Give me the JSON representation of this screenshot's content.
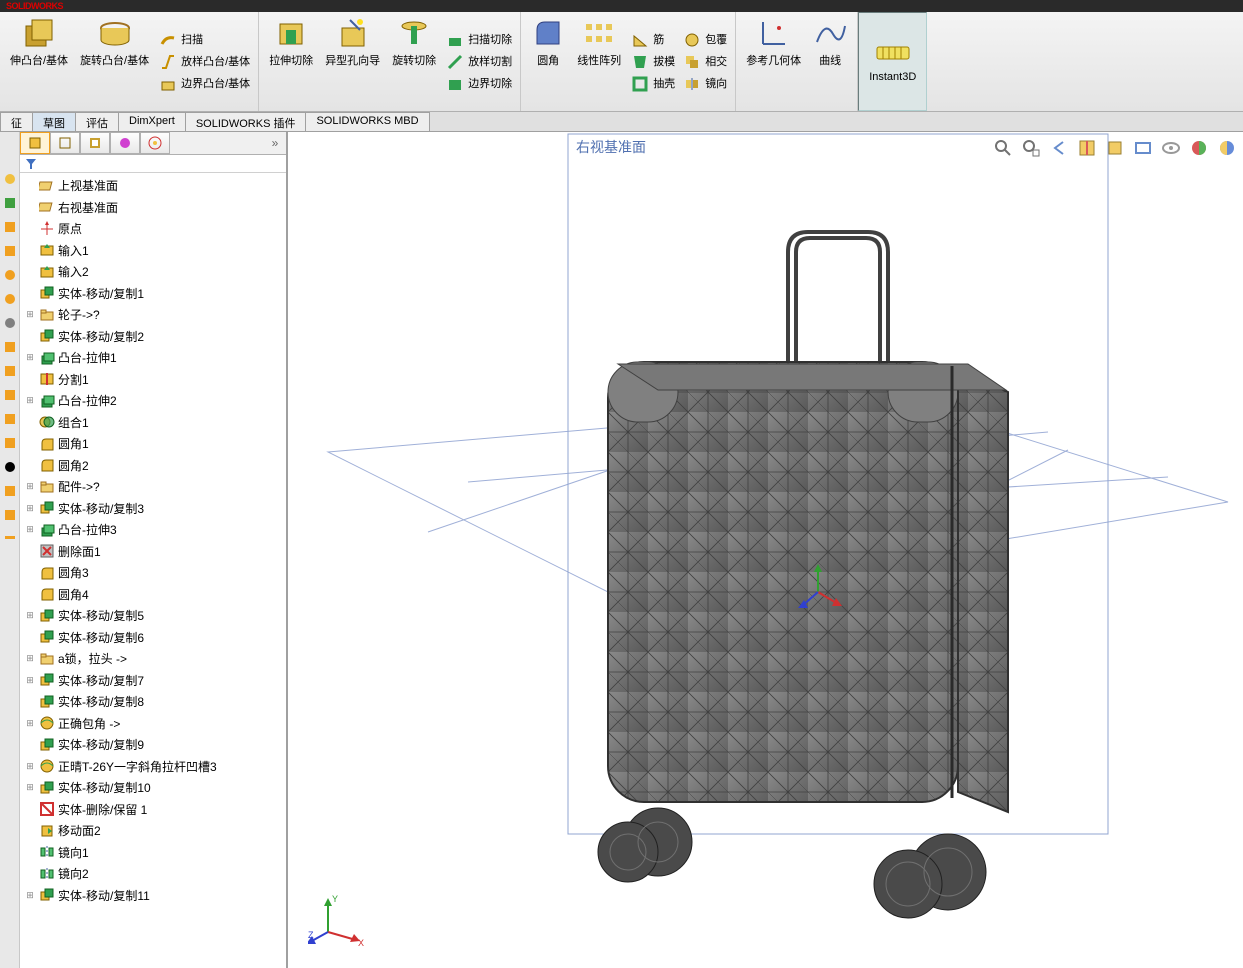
{
  "app": {
    "title": "SOLIDWORKS"
  },
  "ribbon": {
    "group1": {
      "big1": "伸凸台/基体",
      "big2": "旋转凸台/基体",
      "row1": "扫描",
      "row2": "放样凸台/基体",
      "row3": "边界凸台/基体"
    },
    "group2": {
      "big1": "拉伸切除",
      "big2": "异型孔向导",
      "big3": "旋转切除",
      "row1": "扫描切除",
      "row2": "放样切割",
      "row3": "边界切除"
    },
    "group3": {
      "big1": "圆角",
      "big2": "线性阵列",
      "row1": "筋",
      "row2": "拔模",
      "row3": "抽壳",
      "row4": "包覆",
      "row5": "相交",
      "row6": "镜向"
    },
    "group4": {
      "big1": "参考几何体",
      "big2": "曲线"
    },
    "instant3d": "Instant3D"
  },
  "tabs": [
    "征",
    "草图",
    "评估",
    "DimXpert",
    "SOLIDWORKS 插件",
    "SOLIDWORKS MBD"
  ],
  "viewport": {
    "plane_label": "右视基准面"
  },
  "tree": [
    {
      "icon": "plane",
      "label": "上视基准面",
      "exp": ""
    },
    {
      "icon": "plane",
      "label": "右视基准面",
      "exp": ""
    },
    {
      "icon": "origin",
      "label": "原点",
      "exp": ""
    },
    {
      "icon": "import",
      "label": "输入1",
      "exp": ""
    },
    {
      "icon": "import",
      "label": "输入2",
      "exp": ""
    },
    {
      "icon": "movecopy",
      "label": "实体-移动/复制1",
      "exp": ""
    },
    {
      "icon": "folder",
      "label": "轮子->?",
      "exp": "+"
    },
    {
      "icon": "movecopy",
      "label": "实体-移动/复制2",
      "exp": ""
    },
    {
      "icon": "extrude",
      "label": "凸台-拉伸1",
      "exp": "+"
    },
    {
      "icon": "split",
      "label": "分割1",
      "exp": ""
    },
    {
      "icon": "extrude",
      "label": "凸台-拉伸2",
      "exp": "+"
    },
    {
      "icon": "combine",
      "label": "组合1",
      "exp": ""
    },
    {
      "icon": "fillet",
      "label": "圆角1",
      "exp": ""
    },
    {
      "icon": "fillet",
      "label": "圆角2",
      "exp": ""
    },
    {
      "icon": "folder",
      "label": "配件->?",
      "exp": "+"
    },
    {
      "icon": "movecopy",
      "label": "实体-移动/复制3",
      "exp": "+"
    },
    {
      "icon": "extrude",
      "label": "凸台-拉伸3",
      "exp": "+"
    },
    {
      "icon": "deleteface",
      "label": "删除面1",
      "exp": ""
    },
    {
      "icon": "fillet",
      "label": "圆角3",
      "exp": ""
    },
    {
      "icon": "fillet",
      "label": "圆角4",
      "exp": ""
    },
    {
      "icon": "movecopy",
      "label": "实体-移动/复制5",
      "exp": "+"
    },
    {
      "icon": "movecopy",
      "label": "实体-移动/复制6",
      "exp": ""
    },
    {
      "icon": "folder",
      "label": "a锁，拉头 ->",
      "exp": "+"
    },
    {
      "icon": "movecopy",
      "label": "实体-移动/复制7",
      "exp": "+"
    },
    {
      "icon": "movecopy",
      "label": "实体-移动/复制8",
      "exp": ""
    },
    {
      "icon": "wrap",
      "label": "正确包角 ->",
      "exp": "+"
    },
    {
      "icon": "movecopy",
      "label": "实体-移动/复制9",
      "exp": ""
    },
    {
      "icon": "wrap",
      "label": "正晴T-26Y一字斜角拉杆凹槽3",
      "exp": "+"
    },
    {
      "icon": "movecopy",
      "label": "实体-移动/复制10",
      "exp": "+"
    },
    {
      "icon": "deletekeep",
      "label": "实体-删除/保留 1",
      "exp": ""
    },
    {
      "icon": "moveface",
      "label": "移动面2",
      "exp": ""
    },
    {
      "icon": "mirror",
      "label": "镜向1",
      "exp": ""
    },
    {
      "icon": "mirror",
      "label": "镜向2",
      "exp": ""
    },
    {
      "icon": "movecopy",
      "label": "实体-移动/复制11",
      "exp": "+"
    }
  ]
}
